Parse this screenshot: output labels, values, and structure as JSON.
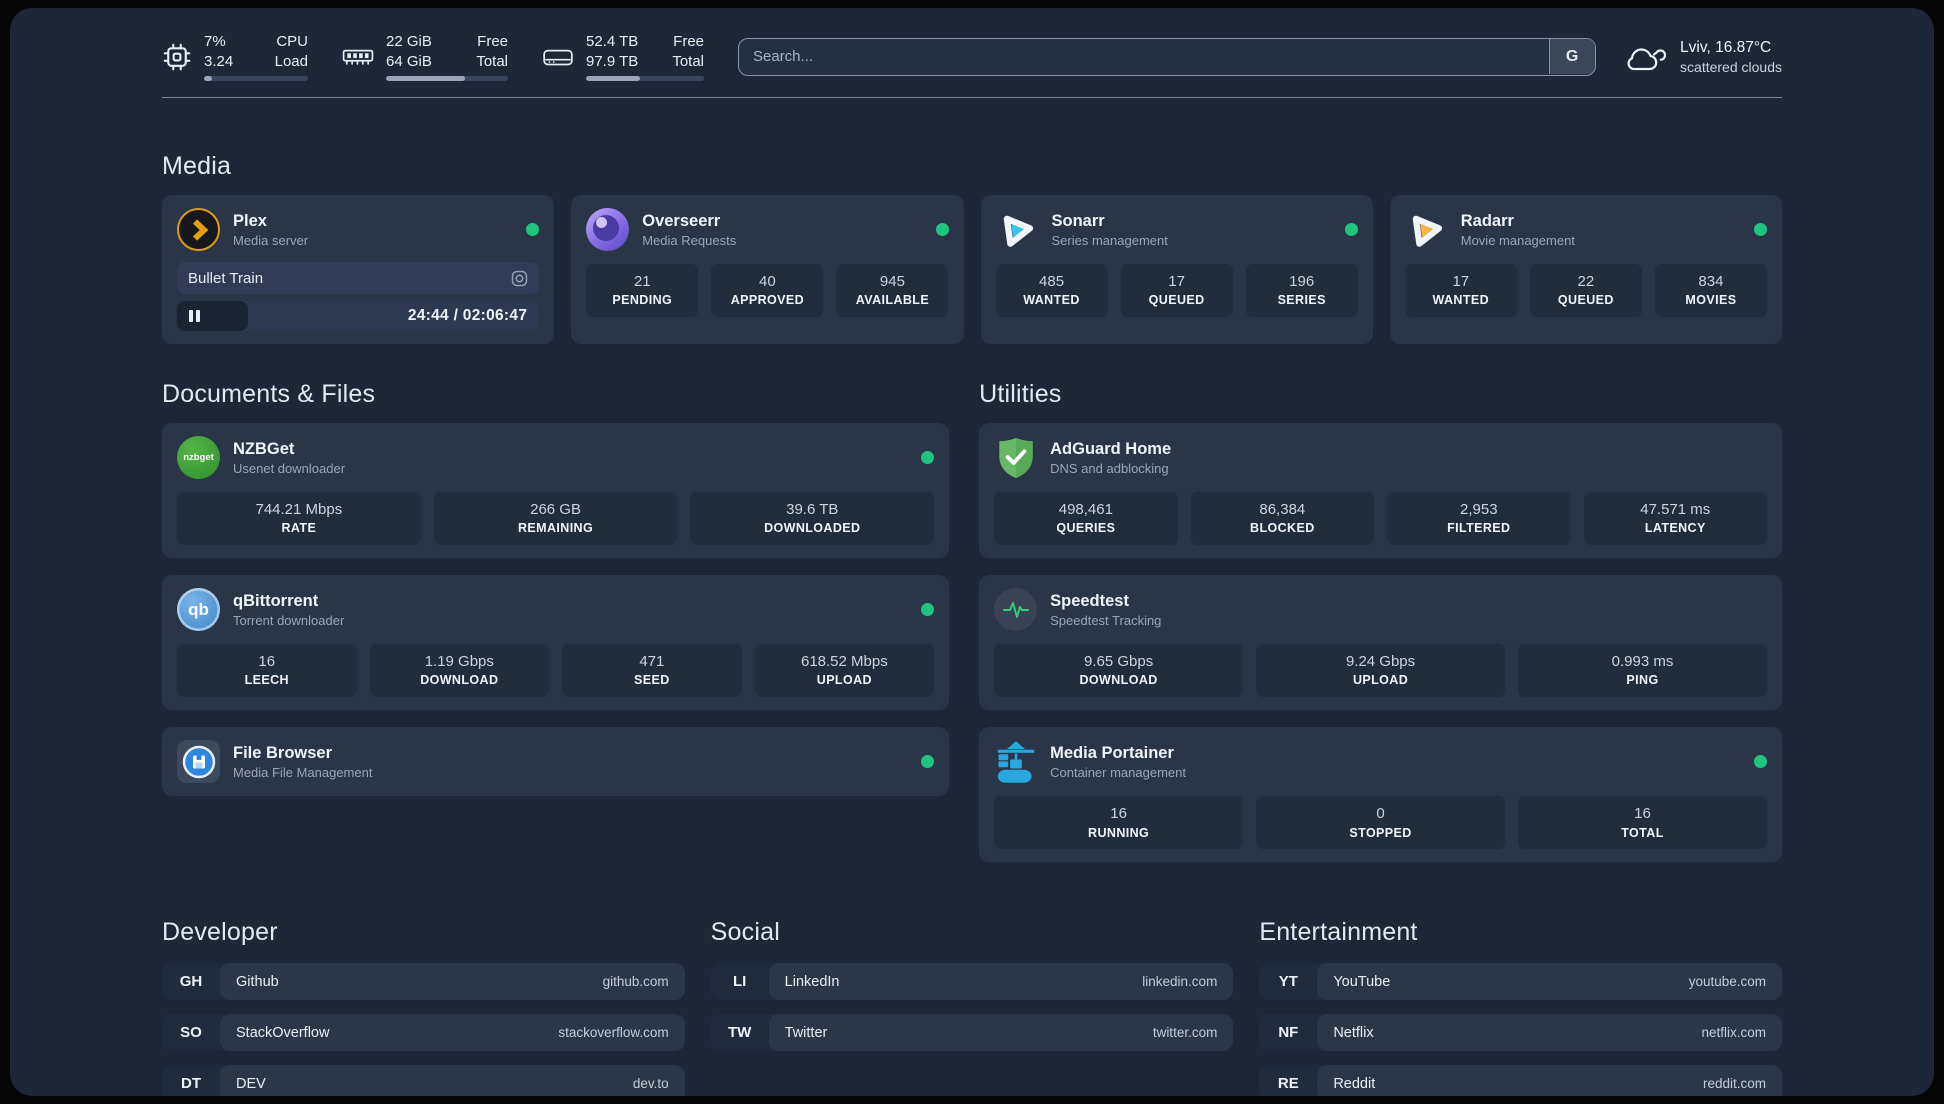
{
  "topbar": {
    "cpu": {
      "value1": "7%",
      "value2": "3.24",
      "label1": "CPU",
      "label2": "Load",
      "usage": 8
    },
    "memory": {
      "value1": "22 GiB",
      "value2": "64 GiB",
      "label1": "Free",
      "label2": "Total",
      "usage": 65
    },
    "disk": {
      "value1": "52.4 TB",
      "value2": "97.9 TB",
      "label1": "Free",
      "label2": "Total",
      "usage": 46
    },
    "search": {
      "placeholder": "Search...",
      "button": "G"
    },
    "weather": {
      "location": "Lviv, 16.87°C",
      "condition": "scattered clouds"
    }
  },
  "media": {
    "heading": "Media",
    "plex": {
      "title": "Plex",
      "subtitle": "Media server",
      "now_playing": {
        "title": "Bullet Train",
        "time": "24:44 / 02:06:47",
        "progress": 19.5
      }
    },
    "overseerr": {
      "title": "Overseerr",
      "subtitle": "Media Requests",
      "stats": [
        {
          "value": "21",
          "label": "PENDING"
        },
        {
          "value": "40",
          "label": "APPROVED"
        },
        {
          "value": "945",
          "label": "AVAILABLE"
        }
      ]
    },
    "sonarr": {
      "title": "Sonarr",
      "subtitle": "Series management",
      "stats": [
        {
          "value": "485",
          "label": "WANTED"
        },
        {
          "value": "17",
          "label": "QUEUED"
        },
        {
          "value": "196",
          "label": "SERIES"
        }
      ]
    },
    "radarr": {
      "title": "Radarr",
      "subtitle": "Movie management",
      "stats": [
        {
          "value": "17",
          "label": "WANTED"
        },
        {
          "value": "22",
          "label": "QUEUED"
        },
        {
          "value": "834",
          "label": "MOVIES"
        }
      ]
    }
  },
  "documents": {
    "heading": "Documents & Files",
    "nzbget": {
      "title": "NZBGet",
      "subtitle": "Usenet downloader",
      "stats": [
        {
          "value": "744.21 Mbps",
          "label": "RATE"
        },
        {
          "value": "266 GB",
          "label": "REMAINING"
        },
        {
          "value": "39.6 TB",
          "label": "DOWNLOADED"
        }
      ]
    },
    "qbittorrent": {
      "title": "qBittorrent",
      "subtitle": "Torrent downloader",
      "stats": [
        {
          "value": "16",
          "label": "LEECH"
        },
        {
          "value": "1.19 Gbps",
          "label": "DOWNLOAD"
        },
        {
          "value": "471",
          "label": "SEED"
        },
        {
          "value": "618.52 Mbps",
          "label": "UPLOAD"
        }
      ]
    },
    "filebrowser": {
      "title": "File Browser",
      "subtitle": "Media File Management"
    }
  },
  "utilities": {
    "heading": "Utilities",
    "adguard": {
      "title": "AdGuard Home",
      "subtitle": "DNS and adblocking",
      "stats": [
        {
          "value": "498,461",
          "label": "QUERIES"
        },
        {
          "value": "86,384",
          "label": "BLOCKED"
        },
        {
          "value": "2,953",
          "label": "FILTERED"
        },
        {
          "value": "47.571 ms",
          "label": "LATENCY"
        }
      ]
    },
    "speedtest": {
      "title": "Speedtest",
      "subtitle": "Speedtest Tracking",
      "stats": [
        {
          "value": "9.65 Gbps",
          "label": "DOWNLOAD"
        },
        {
          "value": "9.24 Gbps",
          "label": "UPLOAD"
        },
        {
          "value": "0.993 ms",
          "label": "PING"
        }
      ]
    },
    "portainer": {
      "title": "Media Portainer",
      "subtitle": "Container management",
      "stats": [
        {
          "value": "16",
          "label": "RUNNING"
        },
        {
          "value": "0",
          "label": "STOPPED"
        },
        {
          "value": "16",
          "label": "TOTAL"
        }
      ]
    }
  },
  "bookmarks": {
    "developer": {
      "heading": "Developer",
      "links": [
        {
          "abbr": "GH",
          "name": "Github",
          "url": "github.com"
        },
        {
          "abbr": "SO",
          "name": "StackOverflow",
          "url": "stackoverflow.com"
        },
        {
          "abbr": "DT",
          "name": "DEV",
          "url": "dev.to"
        }
      ]
    },
    "social": {
      "heading": "Social",
      "links": [
        {
          "abbr": "LI",
          "name": "LinkedIn",
          "url": "linkedin.com"
        },
        {
          "abbr": "TW",
          "name": "Twitter",
          "url": "twitter.com"
        }
      ]
    },
    "entertainment": {
      "heading": "Entertainment",
      "links": [
        {
          "abbr": "YT",
          "name": "YouTube",
          "url": "youtube.com"
        },
        {
          "abbr": "NF",
          "name": "Netflix",
          "url": "netflix.com"
        },
        {
          "abbr": "RE",
          "name": "Reddit",
          "url": "reddit.com"
        }
      ]
    }
  },
  "icon_text": {
    "nzbget_label": "nzbget",
    "qbittorrent_label": "qb"
  },
  "colors": {
    "status_online": "#1fc47f",
    "plex_gold": "#e5a00d",
    "sonarr_blue": "#38c5f4",
    "radarr_amber": "#ffb53c",
    "portainer_blue": "#2aa7e0",
    "adguard_green": "#67b968",
    "speedtest_pulse": "#2fd07e"
  }
}
